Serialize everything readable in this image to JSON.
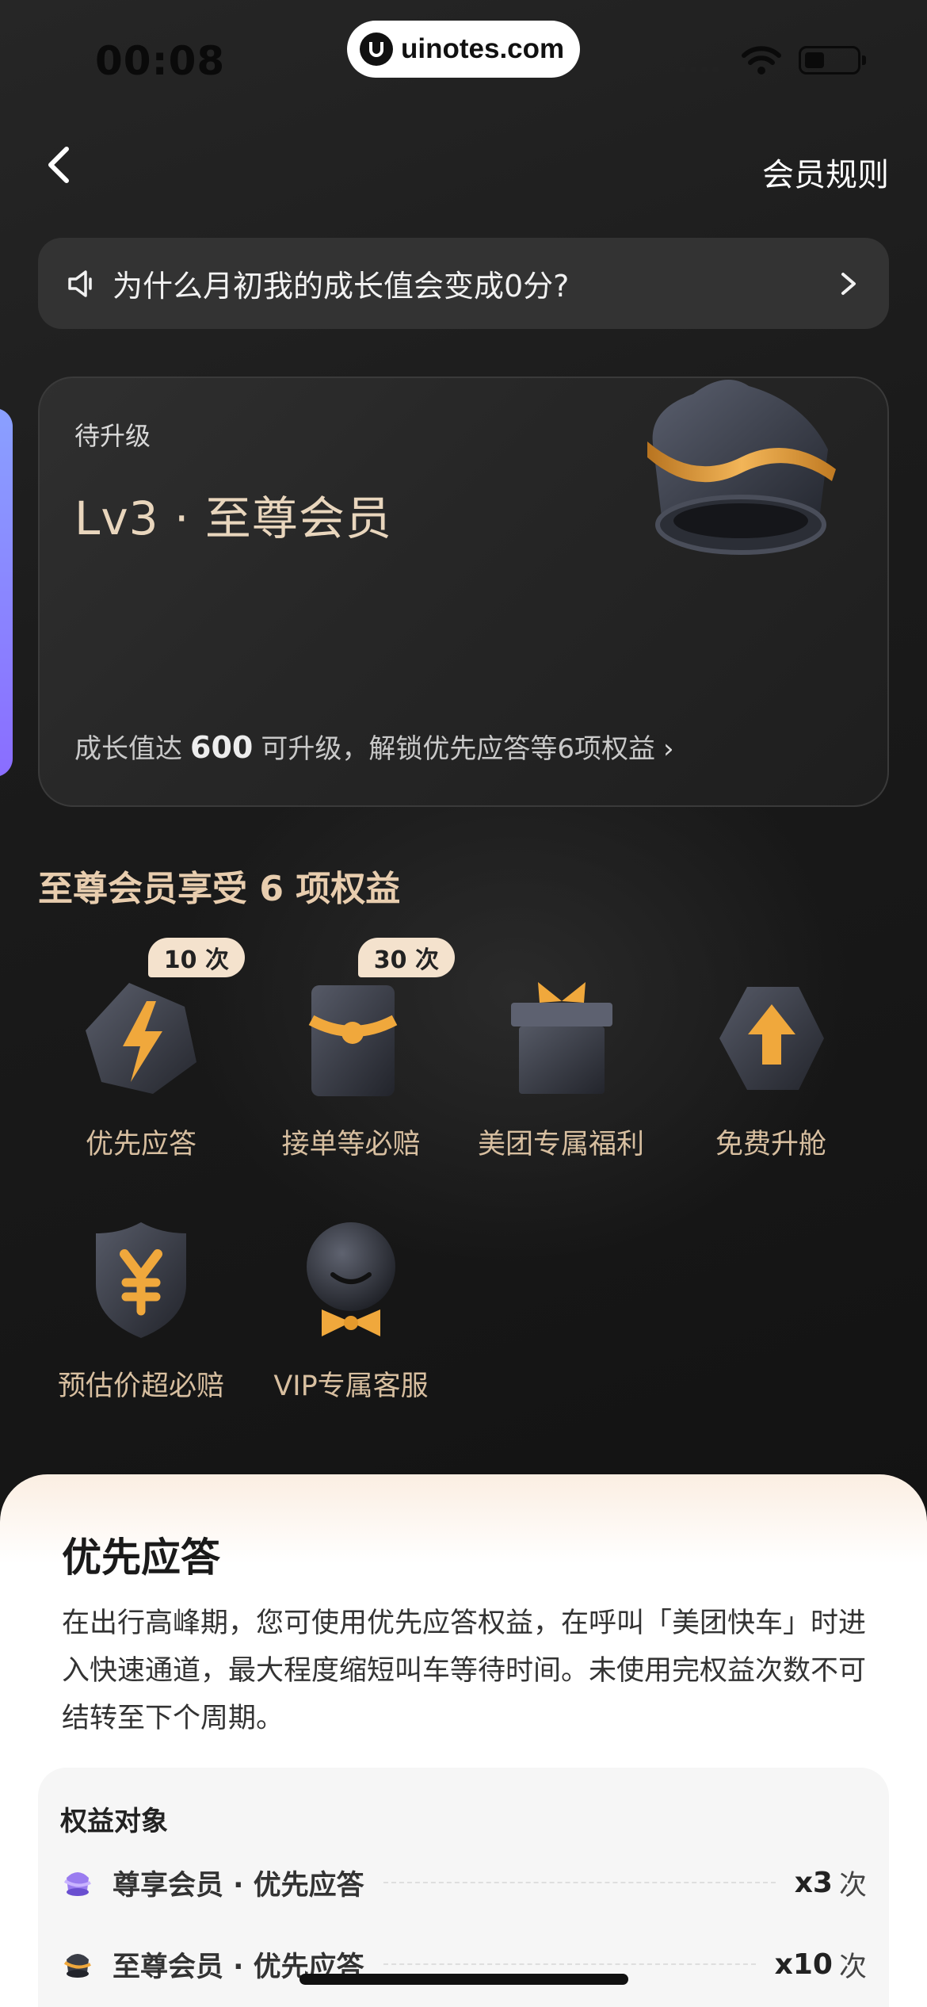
{
  "status_bar": {
    "time": "00:08",
    "watermark": "uinotes.com"
  },
  "nav": {
    "back_icon": "chevron-left-icon",
    "rules_label": "会员规则"
  },
  "notice": {
    "icon": "speaker-icon",
    "text": "为什么月初我的成长值会变成0分?",
    "arrow_icon": "chevron-right-icon"
  },
  "level_card": {
    "status": "待升级",
    "level": "Lv3 · 至尊会员",
    "tip_prefix": "成长值达",
    "tip_value": "600",
    "tip_suffix": "可升级，解锁优先应答等6项权益",
    "tip_arrow": "›"
  },
  "benefits": {
    "title": "至尊会员享受 6 项权益",
    "items": [
      {
        "label": "优先应答",
        "badge": "10 次",
        "icon": "lightning-icon"
      },
      {
        "label": "接单等必赔",
        "badge": "30 次",
        "icon": "envelope-icon"
      },
      {
        "label": "美团专属福利",
        "badge": "",
        "icon": "gift-icon"
      },
      {
        "label": "免费升舱",
        "badge": "",
        "icon": "upgrade-arrow-icon"
      },
      {
        "label": "预估价超必赔",
        "badge": "",
        "icon": "yen-shield-icon"
      },
      {
        "label": "VIP专属客服",
        "badge": "",
        "icon": "customer-service-icon"
      }
    ]
  },
  "sheet": {
    "title": "优先应答",
    "description": "在出行高峰期，您可使用优先应答权益，在呼叫「美团快车」时进入快速通道，最大程度缩短叫车等待时间。未使用完权益次数不可结转至下个周期。",
    "target_title": "权益对象",
    "targets": [
      {
        "name": "尊享会员 · 优先应答",
        "count": "x3",
        "unit": "次",
        "icon": "purple-crown-icon"
      },
      {
        "name": "至尊会员 · 优先应答",
        "count": "x10",
        "unit": "次",
        "icon": "dark-crown-icon"
      }
    ]
  },
  "colors": {
    "background": "#141414",
    "accent_gold": "#e8a33a",
    "benefit_label": "#d8bfa0",
    "level_title": "#e9d6bd"
  }
}
